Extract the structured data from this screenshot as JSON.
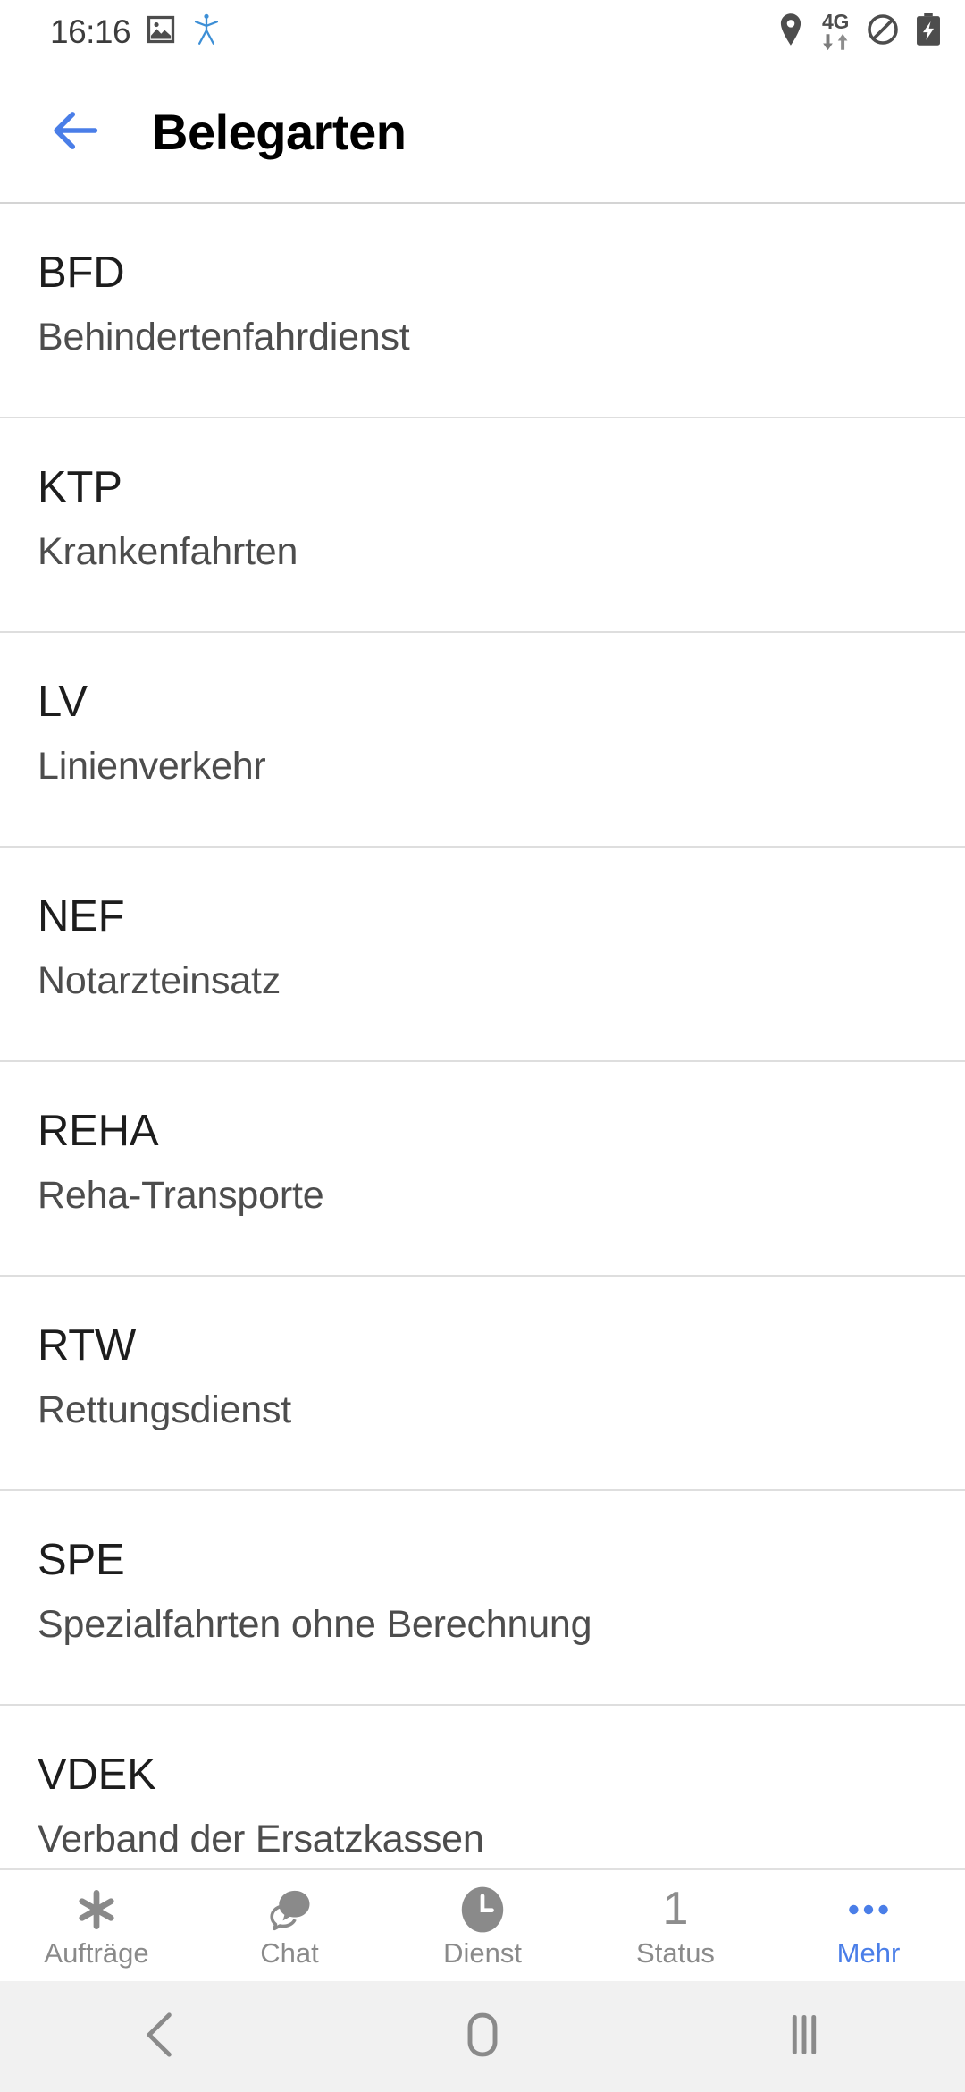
{
  "status_bar": {
    "time": "16:16",
    "left_icons": [
      "image-icon",
      "stick-figure-icon"
    ],
    "right_icons": [
      "location-pin-icon",
      "4g-data-icon",
      "do-not-disturb-icon",
      "battery-charging-icon"
    ],
    "network_label": "4G",
    "accent_blue": "#4a7ee8",
    "icon_gray": "#4d4d4d"
  },
  "app_bar": {
    "back_icon": "arrow-left-icon",
    "title": "Belegarten",
    "accent": "#4a7ee8"
  },
  "list": {
    "items": [
      {
        "code": "BFD",
        "desc": "Behindertenfahrdienst"
      },
      {
        "code": "KTP",
        "desc": "Krankenfahrten"
      },
      {
        "code": "LV",
        "desc": "Linienverkehr"
      },
      {
        "code": "NEF",
        "desc": "Notarzteinsatz"
      },
      {
        "code": "REHA",
        "desc": "Reha-Transporte"
      },
      {
        "code": "RTW",
        "desc": "Rettungsdienst"
      },
      {
        "code": "SPE",
        "desc": "Spezialfahrten ohne Berechnung"
      },
      {
        "code": "VDEK",
        "desc": "Verband der Ersatzkassen"
      }
    ]
  },
  "tab_bar": {
    "items": [
      {
        "label": "Aufträge",
        "icon": "asterisk-icon",
        "active": false
      },
      {
        "label": "Chat",
        "icon": "chat-bubble-icon",
        "active": false
      },
      {
        "label": "Dienst",
        "icon": "clock-icon",
        "active": false
      },
      {
        "label": "Status",
        "icon": "number-badge",
        "badge": "1",
        "active": false
      },
      {
        "label": "Mehr",
        "icon": "ellipsis-icon",
        "active": true
      }
    ],
    "inactive_color": "#8a8a8a",
    "active_color": "#4a7ee8"
  },
  "nav_bar": {
    "buttons": [
      {
        "name": "back",
        "icon": "chevron-left-icon"
      },
      {
        "name": "home",
        "icon": "home-square-icon"
      },
      {
        "name": "recents",
        "icon": "recents-bars-icon"
      }
    ],
    "background": "#f1f1f1"
  }
}
